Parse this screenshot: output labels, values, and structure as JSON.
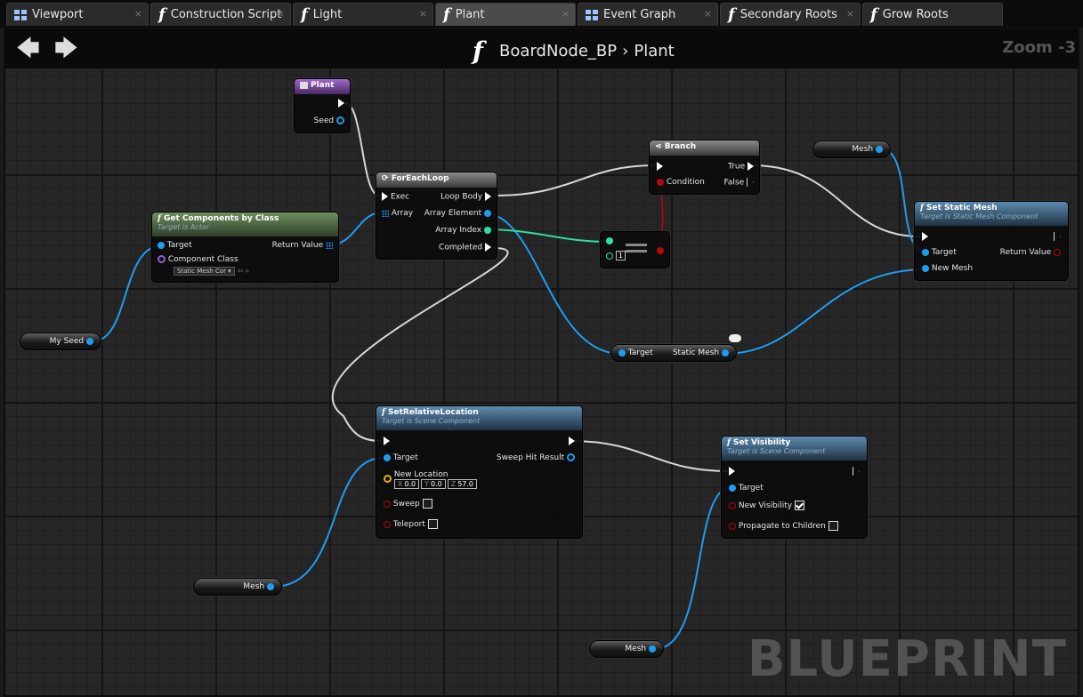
{
  "tabs": [
    {
      "icon": "event-graph-icon",
      "label": "Viewport"
    },
    {
      "icon": "function-icon",
      "label": "Construction Script"
    },
    {
      "icon": "function-icon",
      "label": "Light"
    },
    {
      "icon": "function-icon",
      "label": "Plant"
    },
    {
      "icon": "event-graph-icon",
      "label": "Event Graph"
    },
    {
      "icon": "function-icon",
      "label": "Secondary Roots"
    },
    {
      "icon": "function-icon",
      "label": "Grow Roots"
    }
  ],
  "tab_close": "×",
  "header": {
    "back_icon": "🡄",
    "forward_icon": "🡆",
    "function_glyph": "f",
    "blueprint_name": "BoardNode_BP",
    "separator": "›",
    "function_name": "Plant",
    "zoom": "Zoom -3"
  },
  "watermark": "BLUEPRINT",
  "nodes": {
    "plant": {
      "title": "Plant",
      "seed": "Seed"
    },
    "get_components": {
      "title": "Get Components by Class",
      "subtitle": "Target is Actor",
      "target": "Target",
      "return_value": "Return Value",
      "component_class": "Component Class",
      "class_value": "Static Mesh Cor ▾"
    },
    "foreach": {
      "title": "ForEachLoop",
      "exec": "Exec",
      "array": "Array",
      "loop_body": "Loop Body",
      "array_element": "Array Element",
      "array_index": "Array Index",
      "completed": "Completed"
    },
    "branch": {
      "title": "Branch",
      "true": "True",
      "condition": "Condition",
      "false": "False"
    },
    "compare": {
      "value": "1"
    },
    "set_static_mesh": {
      "title": "Set Static Mesh",
      "subtitle": "Target is Static Mesh Component",
      "target": "Target",
      "return_value": "Return Value",
      "new_mesh": "New Mesh"
    },
    "target_static_mesh": {
      "target": "Target",
      "static_mesh": "Static Mesh"
    },
    "set_relative_location": {
      "title": "SetRelativeLocation",
      "subtitle": "Target is Scene Component",
      "target": "Target",
      "sweep_hit_result": "Sweep Hit Result",
      "new_location": "New Location",
      "x": "0.0",
      "y": "0.0",
      "z": "57.0",
      "x_label": "X",
      "y_label": "Y",
      "z_label": "Z",
      "sweep": "Sweep",
      "teleport": "Teleport"
    },
    "set_visibility": {
      "title": "Set Visibility",
      "subtitle": "Target is Scene Component",
      "target": "Target",
      "new_visibility": "New Visibility",
      "propagate": "Propagate to Children",
      "new_visibility_checked": true,
      "propagate_checked": false
    }
  },
  "variables": {
    "my_seed": "My Seed",
    "mesh_top": "Mesh",
    "mesh_left": "Mesh",
    "mesh_bottom": "Mesh"
  },
  "colors": {
    "object_pin": "#1e9cf0",
    "int_pin": "#2de0a0",
    "bool_pin": "#b8050b",
    "vector_pin": "#e0b400",
    "class_pin": "#9a5ad9",
    "exec_wire": "#d8d8d8",
    "function_header": "#5d89ad",
    "pure_header": "#6f8f5e",
    "event_header": "#a06acb"
  }
}
